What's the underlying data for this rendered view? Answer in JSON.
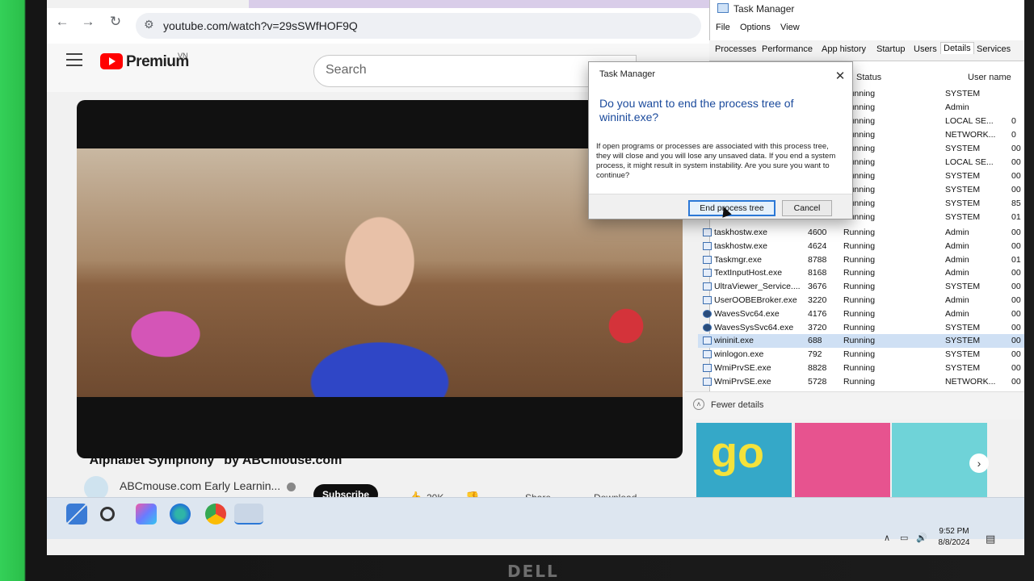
{
  "browser": {
    "url": "youtube.com/watch?v=29sSWfHOF9Q"
  },
  "youtube": {
    "brand": "Premium",
    "region": "VN",
    "search_placeholder": "Search",
    "video_title": "\"Alphabet Symphony\" by ABCmouse.com",
    "channel": "ABCmouse.com Early Learnin...",
    "subscribe": "Subscribe",
    "likes": "20K",
    "share": "Share",
    "download": "Download",
    "more": "...",
    "thumb_text": "go"
  },
  "taskbar": {
    "time": "9:52 PM",
    "date": "8/8/2024"
  },
  "task_manager": {
    "title": "Task Manager",
    "menu": [
      "File",
      "Options",
      "View"
    ],
    "tabs": [
      "Processes",
      "Performance",
      "App history",
      "Startup",
      "Users",
      "Details",
      "Services"
    ],
    "active_tab": "Details",
    "columns": {
      "status": "Status",
      "user": "User name"
    },
    "top_rows": [
      {
        "status": "Running",
        "user": "SYSTEM"
      },
      {
        "status": "Running",
        "user": "Admin"
      },
      {
        "status": "Running",
        "user": "LOCAL SE..."
      },
      {
        "status": "Running",
        "user": "NETWORK..."
      },
      {
        "status": "Running",
        "user": "SYSTEM"
      },
      {
        "status": "Running",
        "user": "LOCAL SE..."
      },
      {
        "status": "Running",
        "user": "SYSTEM"
      },
      {
        "status": "Running",
        "user": "SYSTEM"
      },
      {
        "status": "Running",
        "user": "SYSTEM"
      },
      {
        "status": "Running",
        "user": "SYSTEM"
      }
    ],
    "top_cpu": [
      "",
      "",
      "0",
      "0",
      "00",
      "00",
      "00",
      "00",
      "85",
      "01"
    ],
    "rows": [
      {
        "name": "taskhostw.exe",
        "pid": "4600",
        "status": "Running",
        "user": "Admin",
        "cpu": "00"
      },
      {
        "name": "taskhostw.exe",
        "pid": "4624",
        "status": "Running",
        "user": "Admin",
        "cpu": "00"
      },
      {
        "name": "Taskmgr.exe",
        "pid": "8788",
        "status": "Running",
        "user": "Admin",
        "cpu": "01"
      },
      {
        "name": "TextInputHost.exe",
        "pid": "8168",
        "status": "Running",
        "user": "Admin",
        "cpu": "00"
      },
      {
        "name": "UltraViewer_Service....",
        "pid": "3676",
        "status": "Running",
        "user": "SYSTEM",
        "cpu": "00"
      },
      {
        "name": "UserOOBEBroker.exe",
        "pid": "3220",
        "status": "Running",
        "user": "Admin",
        "cpu": "00"
      },
      {
        "name": "WavesSvc64.exe",
        "pid": "4176",
        "status": "Running",
        "user": "Admin",
        "cpu": "00"
      },
      {
        "name": "WavesSysSvc64.exe",
        "pid": "3720",
        "status": "Running",
        "user": "SYSTEM",
        "cpu": "00"
      },
      {
        "name": "wininit.exe",
        "pid": "688",
        "status": "Running",
        "user": "SYSTEM",
        "cpu": "00"
      },
      {
        "name": "winlogon.exe",
        "pid": "792",
        "status": "Running",
        "user": "SYSTEM",
        "cpu": "00"
      },
      {
        "name": "WmiPrvSE.exe",
        "pid": "8828",
        "status": "Running",
        "user": "SYSTEM",
        "cpu": "00"
      },
      {
        "name": "WmiPrvSE.exe",
        "pid": "5728",
        "status": "Running",
        "user": "NETWORK...",
        "cpu": "00"
      }
    ],
    "selected_process": "wininit.exe",
    "fewer_details": "Fewer details"
  },
  "dialog": {
    "title": "Task Manager",
    "question": "Do you want to end the process tree of wininit.exe?",
    "body": "If open programs or processes are associated with this process tree, they will close and you will lose any unsaved data. If you end a system process, it might result in system instability. Are you sure you want to continue?",
    "primary": "End process tree",
    "secondary": "Cancel"
  },
  "monitor": {
    "brand": "DELL"
  },
  "colors": {
    "accent": "#2b78d6",
    "youtube_red": "#ff0000",
    "selection": "#cfe0f4"
  }
}
